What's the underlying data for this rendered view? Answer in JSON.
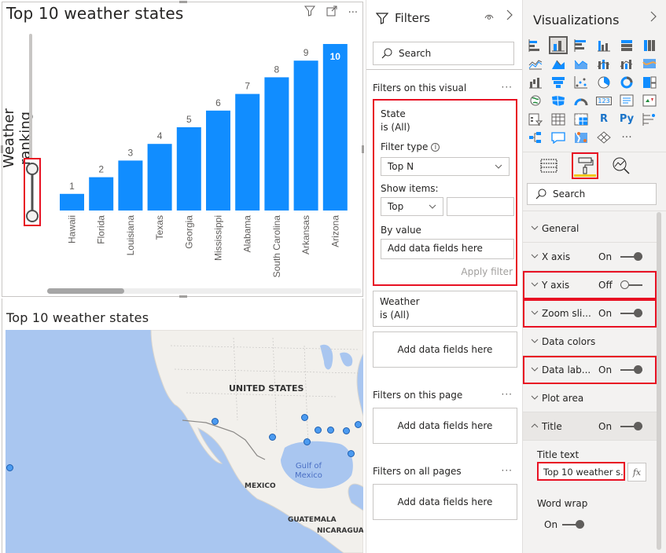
{
  "bar_visual": {
    "title": "Top 10 weather states",
    "y_axis_title": "Weather ranking",
    "header_icons": [
      "filter-icon",
      "focus-mode-icon",
      "more-options-icon"
    ],
    "more_label": "···"
  },
  "chart_data": {
    "type": "bar",
    "title": "Top 10 weather states",
    "xlabel": "",
    "ylabel": "Weather ranking",
    "categories": [
      "Hawaii",
      "Florida",
      "Louisiana",
      "Texas",
      "Georgia",
      "Mississippi",
      "Alabama",
      "South Carolina",
      "Arkansas",
      "Arizona"
    ],
    "values": [
      1,
      2,
      3,
      4,
      5,
      6,
      7,
      8,
      9,
      10
    ],
    "data_labels": [
      "1",
      "2",
      "3",
      "4",
      "5",
      "6",
      "7",
      "8",
      "9",
      "10"
    ],
    "ylim": [
      0,
      10
    ],
    "grid": false,
    "bar_color": "#118dff",
    "zoom_slider": "on"
  },
  "map_visual": {
    "title": "Top 10 weather states",
    "labels": {
      "us": "UNITED STATES",
      "mexico": "MEXICO",
      "gulf_line1": "Gulf of",
      "gulf_line2": "Mexico",
      "guatemala": "GUATEMALA",
      "nicaragua": "NICARAGUA"
    },
    "points": [
      "Hawaii",
      "Arizona",
      "Texas",
      "Arkansas",
      "Louisiana",
      "Mississippi",
      "Alabama",
      "Georgia",
      "South Carolina",
      "Florida"
    ]
  },
  "filters": {
    "title": "Filters",
    "search_placeholder": "Search",
    "visual_section": "Filters on this visual",
    "more": "···",
    "state_card": {
      "field": "State",
      "condition": "is (All)",
      "filter_type_label": "Filter type",
      "filter_type_value": "Top N",
      "show_items_label": "Show items:",
      "show_items_value": "Top",
      "show_items_count": "",
      "by_value_label": "By value",
      "by_value_placeholder": "Add data fields here",
      "apply_label": "Apply filter"
    },
    "weather_card": {
      "field": "Weather",
      "condition": "is (All)"
    },
    "add_fields": "Add data fields here",
    "page_section": "Filters on this page",
    "all_pages_section": "Filters on all pages"
  },
  "visualizations": {
    "title": "Visualizations",
    "icons": [
      "stacked-bar-chart",
      "stacked-column-chart",
      "clustered-bar-chart",
      "clustered-column-chart",
      "100-stacked-bar-chart",
      "100-stacked-column-chart",
      "line-chart",
      "area-chart",
      "stacked-area-chart",
      "line-and-stacked-column-chart",
      "line-and-clustered-column-chart",
      "ribbon-chart",
      "waterfall-chart",
      "funnel-chart",
      "scatter-chart",
      "pie-chart",
      "donut-chart",
      "treemap",
      "map",
      "filled-map",
      "gauge",
      "card",
      "multi-row-card",
      "kpi",
      "slicer",
      "table",
      "matrix",
      "r-script-visual",
      "python-visual",
      "key-influencers",
      "decomposition-tree",
      "q-and-a",
      "arcgis-map",
      "power-apps",
      "more-visuals"
    ],
    "icon_text": {
      "r": "R",
      "py": "Py",
      "card": "123",
      "more": "···"
    },
    "selected_icon": "stacked-column-chart",
    "tabs": [
      "fields-tab",
      "format-tab",
      "analytics-tab"
    ],
    "active_tab": "format-tab",
    "search_placeholder": "Search",
    "properties": [
      {
        "label": "General",
        "state": null
      },
      {
        "label": "X axis",
        "state": "On"
      },
      {
        "label": "Y axis",
        "state": "Off"
      },
      {
        "label": "Zoom sli...",
        "state": "On"
      },
      {
        "label": "Data colors",
        "state": null
      },
      {
        "label": "Data lab...",
        "state": "On"
      },
      {
        "label": "Plot area",
        "state": null
      },
      {
        "label": "Title",
        "state": "On"
      }
    ],
    "title_section": {
      "title_text_label": "Title text",
      "title_text_value": "Top 10 weather s...",
      "fx_label": "fx",
      "word_wrap_label": "Word wrap",
      "word_wrap_state": "On"
    }
  }
}
